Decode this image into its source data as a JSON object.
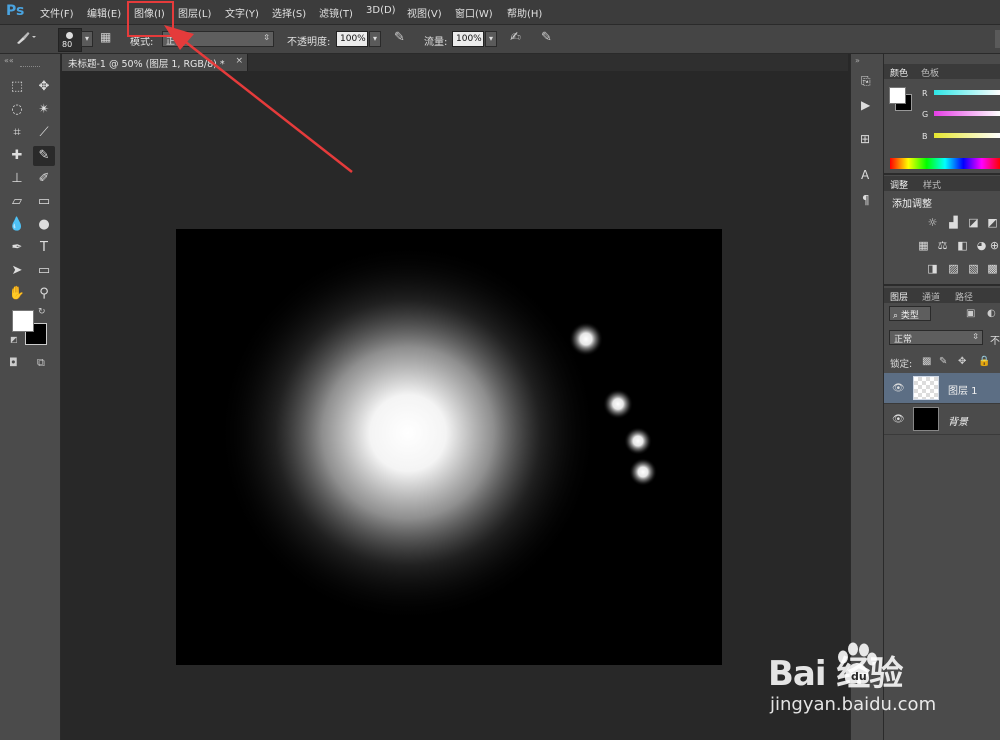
{
  "app": {
    "logo": "Ps"
  },
  "menu": [
    "文件(F)",
    "编辑(E)",
    "图像(I)",
    "图层(L)",
    "文字(Y)",
    "选择(S)",
    "滤镜(T)",
    "3D(D)",
    "视图(V)",
    "窗口(W)",
    "帮助(H)"
  ],
  "options": {
    "brush_size": "80",
    "mode_label": "模式:",
    "mode_value": "正常",
    "opacity_label": "不透明度:",
    "opacity_value": "100%",
    "flow_label": "流量:",
    "flow_value": "100%",
    "tool_icon": "brush-icon",
    "toggle_icons": [
      "brush-panel-icon",
      "pressure-opacity-icon",
      "airbrush-icon",
      "pressure-size-icon"
    ]
  },
  "document": {
    "tab_title": "未标题-1 @ 50% (图层 1, RGB/8) *",
    "close_glyph": "×",
    "soft_spot_count": 5
  },
  "toolbox": {
    "tools": [
      "marquee-icon",
      "move-icon",
      "lasso-icon",
      "magic-wand-icon",
      "crop-icon",
      "eyedropper-icon",
      "healing-brush-icon",
      "brush-icon",
      "clone-stamp-icon",
      "history-brush-icon",
      "eraser-icon",
      "gradient-icon",
      "blur-icon",
      "dodge-icon",
      "pen-icon",
      "type-icon",
      "path-selection-icon",
      "rectangle-icon",
      "hand-icon",
      "zoom-icon"
    ],
    "foreground_color": "#ffffff",
    "background_color": "#000000"
  },
  "panels": {
    "color": {
      "tabs": [
        "颜色",
        "色板"
      ],
      "channels": [
        "R",
        "G",
        "B"
      ],
      "channel_colors": [
        "#2ee6e6",
        "#e63ee6",
        "#e6e62e"
      ]
    },
    "adjustments": {
      "tabs": [
        "调整",
        "样式"
      ],
      "title": "添加调整",
      "icons": [
        "brightness-icon",
        "levels-icon",
        "curves-icon",
        "exposure-icon",
        "vibrance-icon",
        "hue-saturation-icon",
        "color-balance-icon",
        "black-white-icon",
        "photo-filter-icon",
        "channel-mixer-icon",
        "invert-icon",
        "posterize-icon",
        "threshold-icon",
        "gradient-map-icon",
        "selective-color-icon"
      ]
    },
    "layers": {
      "tabs": [
        "图层",
        "通道",
        "路径"
      ],
      "filter_label": "类型",
      "blend_mode": "正常",
      "opacity_label": "不",
      "lock_label": "锁定:",
      "items": [
        {
          "name": "图层 1",
          "selected": true
        },
        {
          "name": "背景",
          "selected": false
        }
      ]
    }
  },
  "dock_icons": [
    "history-icon",
    "actions-icon",
    "3d-icon",
    "character-icon",
    "paragraph-icon"
  ],
  "annotations": {
    "highlight_color": "#e53b3b"
  },
  "watermark": {
    "brand": "Bai  经验",
    "url": "jingyan.baidu.com"
  }
}
